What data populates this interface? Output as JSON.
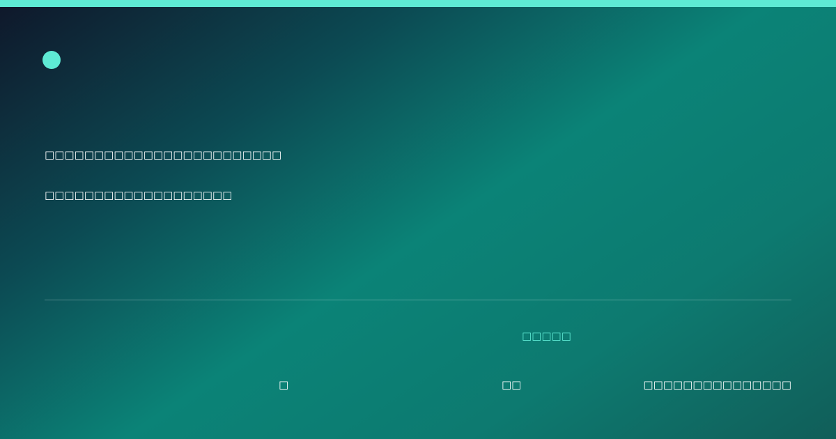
{
  "card": {
    "accent_color": "#5eead4",
    "logo_icon": "circle-dot-icon",
    "headline_line_1": "□□□□□□□□□□□□□□□□□□□□□□□□",
    "headline_line_2": "□□□□□□□□□□□□□□□□□□□",
    "accent_label": "□□□□□",
    "meta_1": "□",
    "meta_2": "□□",
    "meta_3": "□□□□□□□□□□□□□□□"
  }
}
